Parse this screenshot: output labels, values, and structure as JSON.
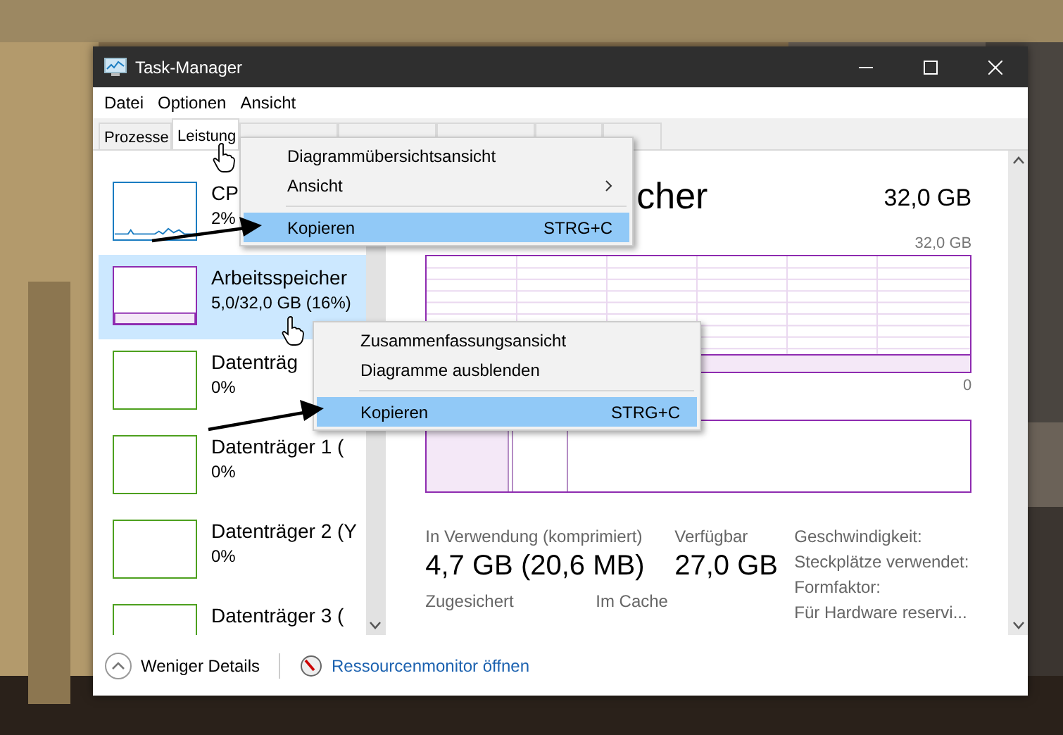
{
  "window": {
    "title": "Task-Manager"
  },
  "menu_bar": [
    "Datei",
    "Optionen",
    "Ansicht"
  ],
  "tabs": [
    {
      "label": "Prozesse",
      "selected": false
    },
    {
      "label": "Leistung",
      "selected": true
    },
    {
      "selected": false
    },
    {
      "selected": false
    },
    {
      "selected": false
    },
    {
      "selected": false
    },
    {
      "selected": false
    }
  ],
  "sidebar": {
    "items": [
      {
        "kind": "cpu",
        "name": "CP",
        "value": "2%",
        "selected": false
      },
      {
        "kind": "memory",
        "name": "Arbeitsspeicher",
        "value": "5,0/32,0 GB (16%)",
        "selected": true
      },
      {
        "kind": "disk",
        "name": "Datenträg",
        "value": "0%",
        "selected": false
      },
      {
        "kind": "disk",
        "name": "Datenträger 1 (",
        "value": "0%",
        "selected": false
      },
      {
        "kind": "disk",
        "name": "Datenträger 2 (Y",
        "value": "0%",
        "selected": false
      },
      {
        "kind": "disk",
        "name": "Datenträger 3 (",
        "selected": false
      }
    ]
  },
  "detail": {
    "title": "cher",
    "total": "32,0 GB",
    "chart_max": "32,0 GB",
    "chart_min": "0",
    "stat_rows": [
      {
        "items": [
          {
            "label": "In Verwendung (komprimiert)",
            "value": "4,7 GB (20,6 MB)"
          },
          {
            "label": "Verfügbar",
            "value": "27,0 GB"
          }
        ]
      },
      {
        "items": [
          {
            "label": "Zugesichert"
          },
          {
            "label": "Im Cache"
          }
        ]
      }
    ],
    "properties": [
      "Geschwindigkeit:",
      "Steckplätze verwendet:",
      "Formfaktor:",
      "Für Hardware reservi..."
    ]
  },
  "footer": {
    "less_details": "Weniger Details",
    "link": "Ressourcenmonitor öffnen"
  },
  "context_menus": [
    {
      "items": [
        {
          "label": "Diagrammübersichtsansicht",
          "selected": false
        },
        {
          "label": "Ansicht",
          "submenu": true,
          "selected": false
        },
        {
          "label": "Kopieren",
          "shortcut": "STRG+C",
          "separator_before": true,
          "selected": true
        }
      ]
    },
    {
      "items": [
        {
          "label": "Zusammenfassungsansicht",
          "selected": false
        },
        {
          "label": "Diagramme ausblenden",
          "selected": false
        },
        {
          "label": "Kopieren",
          "shortcut": "STRG+C",
          "separator_before": true,
          "selected": true
        }
      ]
    }
  ]
}
